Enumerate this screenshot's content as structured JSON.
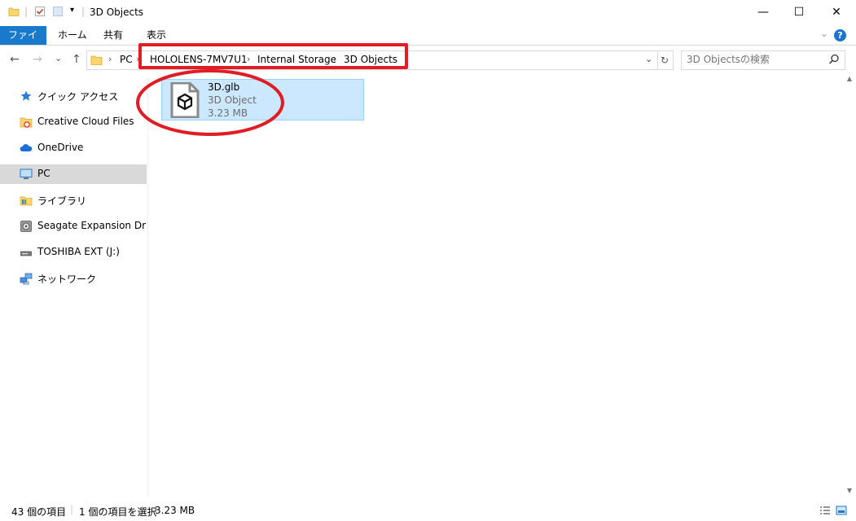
{
  "window": {
    "title": "3D Objects",
    "minimize_glyph": "—",
    "maximize_glyph": "☐",
    "close_glyph": "✕"
  },
  "ribbon": {
    "tabs": [
      "ファイル",
      "ホーム",
      "共有",
      "表示"
    ],
    "help_label": "?",
    "collapse_glyph": "⌄"
  },
  "navigation": {
    "back_glyph": "←",
    "forward_glyph": "→",
    "recent_glyph": "⌄",
    "up_glyph": "↑",
    "breadcrumb": [
      "PC",
      "HOLOLENS-7MV7U1",
      "Internal Storage",
      "3D Objects"
    ],
    "separator": "›",
    "dropdown_glyph": "⌄",
    "refresh_glyph": "↻"
  },
  "search": {
    "placeholder": "3D Objectsの検索"
  },
  "sidebar": {
    "items": [
      {
        "label": "クイック アクセス",
        "icon": "star-icon"
      },
      {
        "label": "Creative Cloud Files",
        "icon": "creative-cloud-folder-icon"
      },
      {
        "label": "OneDrive",
        "icon": "cloud-icon"
      },
      {
        "label": "PC",
        "icon": "monitor-icon",
        "selected": true
      },
      {
        "label": "ライブラリ",
        "icon": "library-icon"
      },
      {
        "label": "Seagate Expansion Drive (",
        "icon": "external-drive-icon"
      },
      {
        "label": "TOSHIBA EXT (J:)",
        "icon": "usb-drive-icon"
      },
      {
        "label": "ネットワーク",
        "icon": "network-icon"
      }
    ]
  },
  "content": {
    "files": [
      {
        "name": "3D.glb",
        "type": "3D Object",
        "size": "3.23 MB",
        "icon": "3d-object-file-icon"
      }
    ]
  },
  "status": {
    "item_count": "43 個の項目",
    "selection": "1 個の項目を選択",
    "selection_size": "3.23 MB"
  },
  "colors": {
    "accent": "#1979ca",
    "selection": "#cce8ff",
    "annotation": "#e01c24"
  }
}
